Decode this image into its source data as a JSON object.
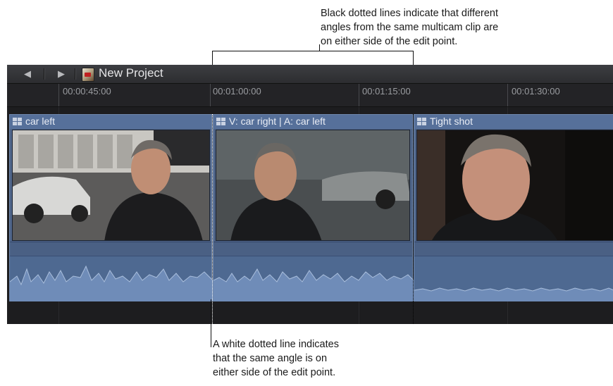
{
  "annotations": {
    "top_callout": [
      "Black dotted lines indicate that different",
      "angles from the same multicam clip are",
      "on either side of the edit point."
    ],
    "bottom_callout": [
      "A white dotted line indicates",
      "that the same angle is on",
      "either side of the edit point."
    ]
  },
  "toolbar": {
    "back_icon": "triangle-left-icon",
    "forward_icon": "triangle-right-icon",
    "project_icon": "project-clapper-icon",
    "project_title": "New Project"
  },
  "ruler": {
    "timecodes": [
      "00:00:45:00",
      "00:01:00:00",
      "00:01:15:00",
      "00:01:30:00"
    ]
  },
  "clips": [
    {
      "label": "car left",
      "icon": "multicam-icon"
    },
    {
      "label": "V: car right | A: car left",
      "icon": "multicam-icon"
    },
    {
      "label": "Tight shot",
      "icon": "multicam-icon"
    }
  ],
  "colors": {
    "clip_blue": "#4e6488",
    "edit_line_same_angle": "#ffffff",
    "edit_line_different_angle": "#000000"
  }
}
